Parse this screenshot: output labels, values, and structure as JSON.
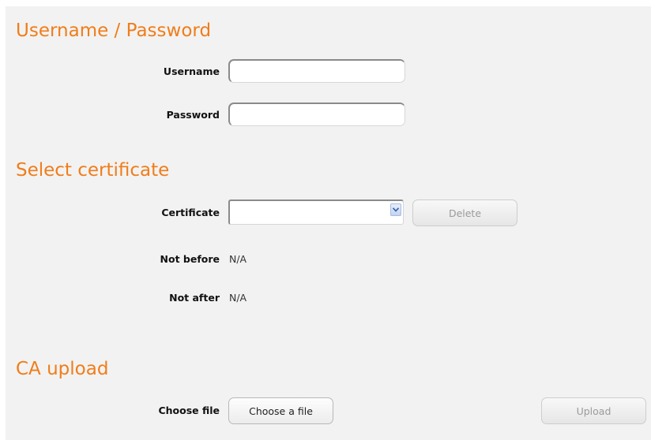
{
  "sections": {
    "credentials": {
      "title": "Username / Password",
      "username_label": "Username",
      "username_value": "",
      "password_label": "Password",
      "password_value": ""
    },
    "certificate": {
      "title": "Select certificate",
      "certificate_label": "Certificate",
      "certificate_selected": "",
      "delete_label": "Delete",
      "not_before_label": "Not before",
      "not_before_value": "N/A",
      "not_after_label": "Not after",
      "not_after_value": "N/A"
    },
    "ca_upload": {
      "title": "CA upload",
      "choose_file_label": "Choose file",
      "choose_button_label": "Choose a file",
      "upload_label": "Upload"
    }
  },
  "icons": {
    "select_arrow": "chevron-down-icon"
  },
  "colors": {
    "heading": "#f07d1a",
    "panel_background": "#f2f2f2",
    "disabled_text": "#9a9a9a"
  }
}
